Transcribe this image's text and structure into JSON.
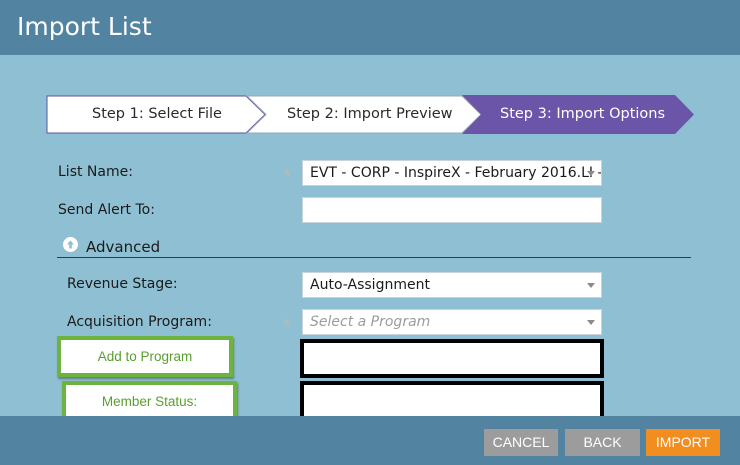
{
  "window": {
    "title": "Import List"
  },
  "wizard": {
    "steps": [
      {
        "label": "Step 1: Select File",
        "state": "inactive"
      },
      {
        "label": "Step 2: Import Preview",
        "state": "inactive"
      },
      {
        "label": "Step 3: Import Options",
        "state": "active"
      }
    ]
  },
  "form": {
    "list_name": {
      "label": "List Name:",
      "value": "EVT - CORP - InspireX - February 2016.LI -",
      "required": true
    },
    "send_alert": {
      "label": "Send Alert To:",
      "value": ""
    },
    "advanced": {
      "label": "Advanced",
      "icon": "arrow-up-circle-icon"
    },
    "revenue_stage": {
      "label": "Revenue Stage:",
      "value": "Auto-Assignment"
    },
    "acquisition_program": {
      "label": "Acquisition Program:",
      "placeholder": "Select a Program",
      "required": true
    },
    "add_to_program": {
      "label": "Add to Program",
      "value": ""
    },
    "member_status": {
      "label": "Member Status:",
      "value": ""
    }
  },
  "footer": {
    "cancel": "CANCEL",
    "back": "BACK",
    "import": "IMPORT"
  },
  "colors": {
    "titlebar": "#5283a0",
    "body": "#8fbfd2",
    "active_step": "#6b55a8",
    "import_button": "#f28d1f",
    "secondary_button": "#9c9c9c",
    "highlight_border": "#6cb33f"
  }
}
